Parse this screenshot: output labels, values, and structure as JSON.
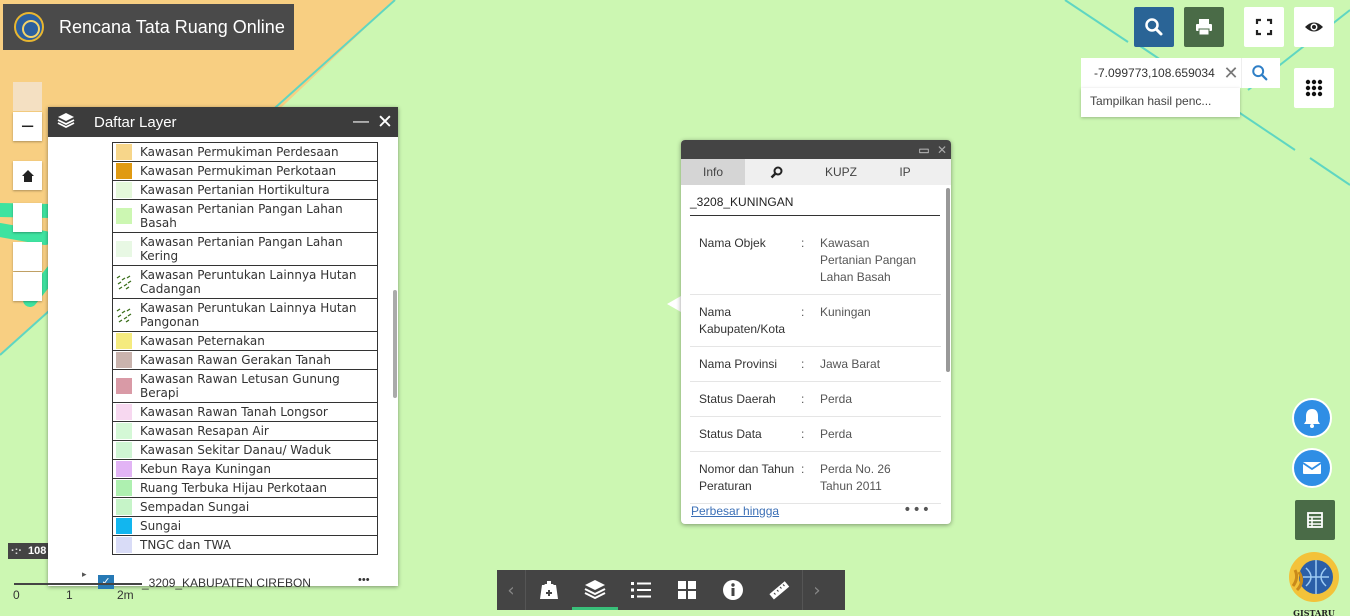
{
  "app": {
    "title": "Rencana Tata Ruang Online"
  },
  "search": {
    "value": "-7.099773,108.659034",
    "suggestion": "Tampilkan hasil penc..."
  },
  "zoom": {
    "out_label": "−",
    "in_label": ""
  },
  "coord_badge": "108",
  "layer_panel": {
    "title": "Daftar Layer",
    "minimize": "—",
    "close": "✕",
    "items": [
      {
        "label": "Kawasan Permukiman Perdesaan",
        "color": "#f7d68a"
      },
      {
        "label": "Kawasan Permukiman Perkotaan",
        "color": "#e09a12"
      },
      {
        "label": "Kawasan Pertanian Hortikultura",
        "color": "#e4f8da"
      },
      {
        "label": "Kawasan Pertanian Pangan Lahan Basah",
        "color": "#ccf7b2"
      },
      {
        "label": "Kawasan Pertanian Pangan Lahan Kering",
        "color": "#e8f8e4"
      },
      {
        "label": "Kawasan Peruntukan Lainnya Hutan Cadangan",
        "color": "pattern"
      },
      {
        "label": "Kawasan Peruntukan Lainnya Hutan Pangonan",
        "color": "pattern"
      },
      {
        "label": "Kawasan Peternakan",
        "color": "#f5eb7e"
      },
      {
        "label": "Kawasan Rawan Gerakan Tanah",
        "color": "#c9b3ad"
      },
      {
        "label": "Kawasan Rawan Letusan Gunung Berapi",
        "color": "#d99aa6"
      },
      {
        "label": "Kawasan Rawan Tanah Longsor",
        "color": "#f7d8f0"
      },
      {
        "label": "Kawasan Resapan Air",
        "color": "#d4f8d6"
      },
      {
        "label": "Kawasan Sekitar Danau/ Waduk",
        "color": "#cff5d4"
      },
      {
        "label": "Kebun Raya Kuningan",
        "color": "#e2b4f5"
      },
      {
        "label": "Ruang Terbuka Hijau Perkotaan",
        "color": "#aef0b0"
      },
      {
        "label": "Sempadan Sungai",
        "color": "#c6f4c8"
      },
      {
        "label": "Sungai",
        "color": "#12b6ef"
      },
      {
        "label": "TNGC dan TWA",
        "color": "#d9dcf7"
      }
    ],
    "next_group": "_3209_KABUPATEN CIREBON",
    "next_group_more": "•••"
  },
  "popup": {
    "tabs": [
      "Info",
      "",
      "KUPZ",
      "IP"
    ],
    "title": "_3208_KUNINGAN",
    "rows": [
      {
        "key": "Nama Objek",
        "value": "Kawasan Pertanian Pangan Lahan Basah"
      },
      {
        "key": "Nama Kabupaten/Kota",
        "value": "Kuningan"
      },
      {
        "key": "Nama Provinsi",
        "value": "Jawa Barat"
      },
      {
        "key": "Status Daerah",
        "value": "Perda"
      },
      {
        "key": "Status Data",
        "value": "Perda"
      },
      {
        "key": "Nomor dan Tahun Peraturan",
        "value": "Perda No. 26 Tahun 2011"
      }
    ],
    "separator": ":",
    "link": "Perbesar hingga",
    "more": "•••"
  },
  "scale": {
    "t0": "0",
    "t1": "1",
    "t2": "2m"
  },
  "footer_logo": "GISTARU",
  "colors": {
    "map_bg": "#ccf7b2",
    "map_orange": "#f8cf82",
    "accent_blue": "#2a6496",
    "print_green": "#4a6b47"
  }
}
